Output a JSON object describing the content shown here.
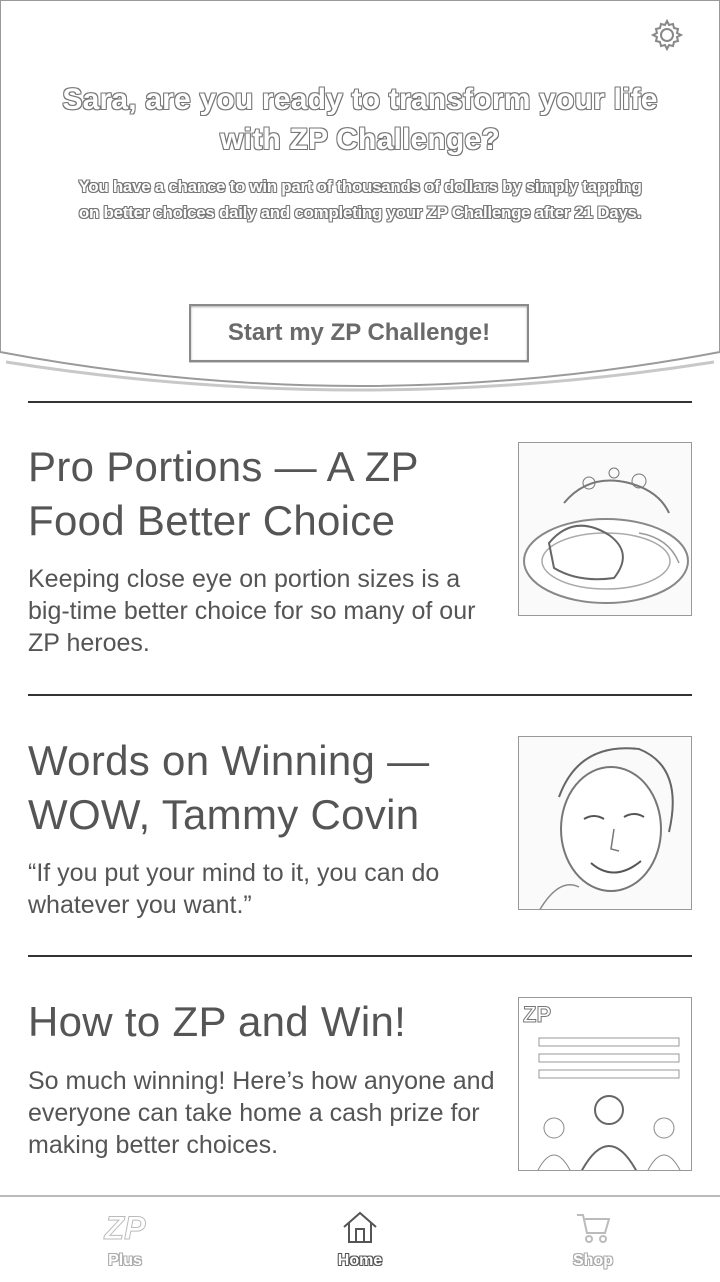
{
  "hero": {
    "title": "Sara, are you ready to transform your life with ZP Challenge?",
    "subtitle": "You have a chance to win part of thousands of dollars by simply tapping on better choices daily and completing your ZP Challenge after 21 Days.",
    "cta_label": "Start my ZP Challenge!"
  },
  "cards": [
    {
      "title": "Pro Portions — A ZP Food Better Choice",
      "body": "Keeping close eye on portion sizes is a big-time better choice for so many of our ZP heroes.",
      "image": "food-plate-image"
    },
    {
      "title": "Words on Winning — WOW, Tammy Covin",
      "body": "“If you put your mind to it, you can do whatever you want.”",
      "image": "portrait-image"
    },
    {
      "title": "How to ZP and Win!",
      "body": "So much winning! Here’s how anyone and everyone can take home a cash prize for making better choices.",
      "image": "winners-image"
    }
  ],
  "nav": {
    "items": [
      {
        "label": "Plus",
        "icon": "zp-logo-icon",
        "logo_text": "ZP"
      },
      {
        "label": "Home",
        "icon": "home-icon"
      },
      {
        "label": "Shop",
        "icon": "cart-icon"
      }
    ],
    "active": "Home"
  },
  "settings_icon": "gear-icon"
}
